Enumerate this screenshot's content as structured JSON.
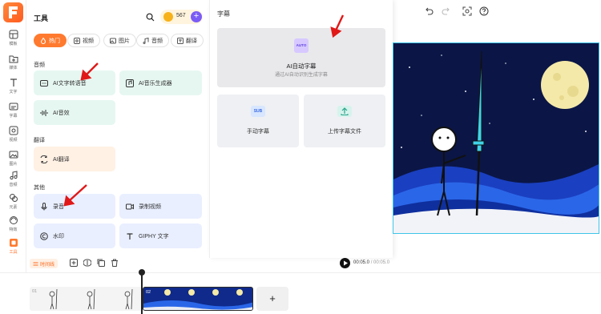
{
  "rail": {
    "items": [
      {
        "label": "模板",
        "icon": "template-icon"
      },
      {
        "label": "媒体",
        "icon": "media-icon"
      },
      {
        "label": "文字",
        "icon": "text-icon"
      },
      {
        "label": "字幕",
        "icon": "subtitle-icon"
      },
      {
        "label": "视频",
        "icon": "video-icon"
      },
      {
        "label": "图片",
        "icon": "image-icon"
      },
      {
        "label": "音频",
        "icon": "audio-icon"
      },
      {
        "label": "元素",
        "icon": "elements-icon"
      },
      {
        "label": "特效",
        "icon": "effects-icon"
      },
      {
        "label": "工具",
        "icon": "tools-icon"
      }
    ]
  },
  "tools": {
    "title": "工具",
    "coins": "567",
    "plus": "+",
    "tabs": [
      {
        "label": "热门",
        "active": true
      },
      {
        "label": "视频"
      },
      {
        "label": "图片"
      },
      {
        "label": "音频"
      },
      {
        "label": "翻译"
      }
    ],
    "sections": {
      "audio": "音频",
      "translate": "翻译",
      "other": "其他"
    },
    "cards": {
      "tts": "AI文字转语音",
      "music": "AI音乐生成器",
      "sfx": "AI音效",
      "translate": "AI翻译",
      "record_audio": "录音",
      "record_video": "录制视频",
      "watermark": "水印",
      "giphy": "GIPHY 文字"
    }
  },
  "subtitle_panel": {
    "title": "字幕",
    "auto_badge": "AUTO",
    "auto_title": "AI自动字幕",
    "auto_desc": "通过AI自动识别生成字幕",
    "manual_badge": "SUB",
    "manual": "手动字幕",
    "upload": "上传字幕文件"
  },
  "playback": {
    "current": "00:05.0",
    "separator": "/",
    "total": "00:05.0"
  },
  "timeline": {
    "button": "时间线",
    "clip1_num": "01",
    "clip2_num": "02",
    "add": "+"
  },
  "colors": {
    "accent": "#ff7a2e",
    "purple": "#7b5cf6",
    "annotation_arrow": "#e01818"
  }
}
